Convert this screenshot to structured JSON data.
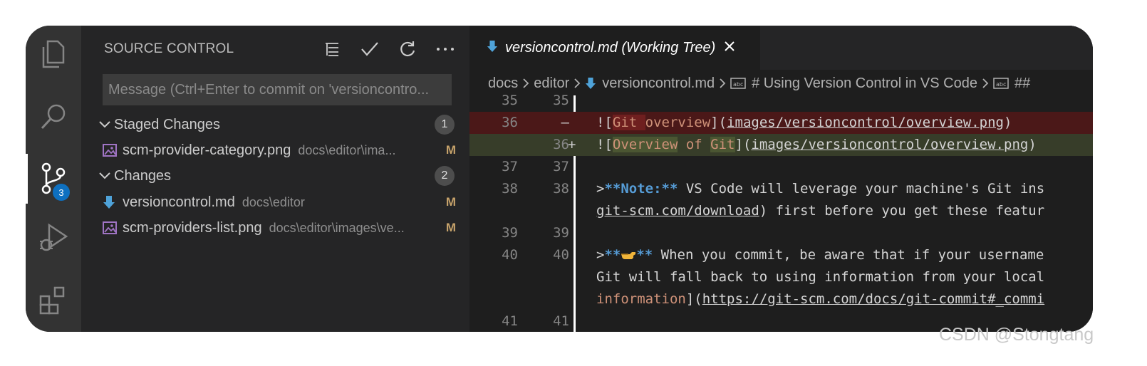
{
  "sidebar": {
    "title": "SOURCE CONTROL",
    "message_placeholder": "Message (Ctrl+Enter to commit on 'versioncontro...",
    "staged": {
      "label": "Staged Changes",
      "count": "1",
      "files": [
        {
          "name": "scm-provider-category.png",
          "path": "docs\\editor\\ima...",
          "status": "M",
          "icon": "image-file-icon"
        }
      ]
    },
    "changes": {
      "label": "Changes",
      "count": "2",
      "files": [
        {
          "name": "versioncontrol.md",
          "path": "docs\\editor",
          "status": "M",
          "icon": "markdown-file-icon"
        },
        {
          "name": "scm-providers-list.png",
          "path": "docs\\editor\\images\\ve...",
          "status": "M",
          "icon": "image-file-icon"
        }
      ]
    }
  },
  "activity_bar": {
    "items": [
      "explorer-icon",
      "search-icon",
      "source-control-icon",
      "run-debug-icon",
      "extensions-icon"
    ],
    "scm_badge": "3"
  },
  "editor": {
    "tab_label": "versioncontrol.md (Working Tree)",
    "breadcrumb": [
      "docs",
      "editor",
      "versioncontrol.md",
      "# Using Version Control in VS Code",
      "##"
    ],
    "lines": [
      {
        "left": "35",
        "right": "35"
      },
      {
        "left": "36",
        "right": "",
        "marker": "—"
      },
      {
        "left": "",
        "right": "36",
        "marker": "+"
      },
      {
        "left": "37",
        "right": "37"
      },
      {
        "left": "38",
        "right": "38"
      },
      {
        "left": "",
        "right": ""
      },
      {
        "left": "39",
        "right": "39"
      },
      {
        "left": "40",
        "right": "40"
      },
      {
        "left": "",
        "right": ""
      },
      {
        "left": "",
        "right": ""
      },
      {
        "left": "41",
        "right": "41"
      }
    ],
    "code": {
      "l36_a": "Git ",
      "l36_b": "overview",
      "l36_link": "images/versioncontrol/overview.png",
      "l36n_a": "Overview",
      "l36n_b": " of ",
      "l36n_c": "Git",
      "l36n_link": "images/versioncontrol/overview.png",
      "l38_note": "**Note:**",
      "l38_text": " VS Code will leverage your machine's Git ins",
      "l38b_link": "git-scm.com/download",
      "l38b_text": ") first before you get these featur",
      "l40_text": " When you commit, be aware that if your username",
      "l40b_text": "Git will fall back to using information from your local",
      "l40c_a": "information",
      "l40c_link": "https://git-scm.com/docs/git-commit#_commi"
    }
  },
  "watermark": "CSDN @Stongtang"
}
